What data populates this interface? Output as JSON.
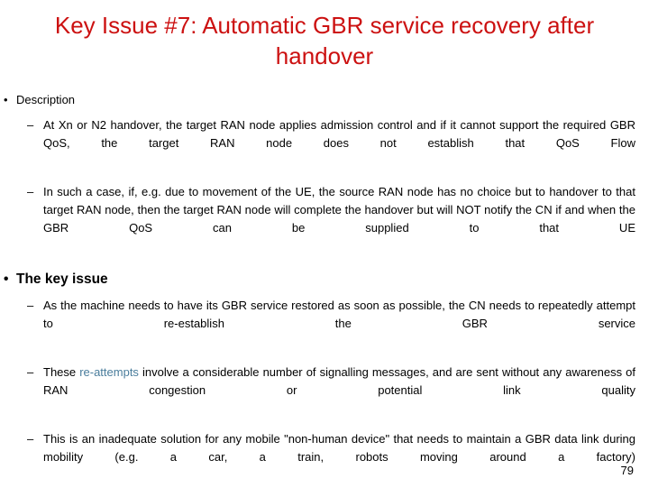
{
  "slide": {
    "title": "Key Issue #7: Automatic GBR service recovery after handover",
    "title_color": "#cc1111",
    "accent_color": "#4a7d9c",
    "page_number": "79",
    "sections": [
      {
        "heading": "Description",
        "bullet_mark": "•",
        "items": [
          {
            "mark": "–",
            "text": "At Xn or N2 handover, the target RAN node applies admission control and if it cannot support the required GBR QoS, the target RAN node does not establish that QoS Flow"
          },
          {
            "mark": "–",
            "text": "In such a case, if, e.g. due to movement of the UE, the source RAN node has no choice but to handover to that target RAN node, then the target RAN node will complete the handover but will NOT notify the CN if and when the GBR QoS can be supplied to that UE"
          }
        ]
      },
      {
        "heading": "The key issue",
        "bullet_mark": "•",
        "items": [
          {
            "mark": "–",
            "text": "As the machine needs to have its GBR service restored as soon as possible, the CN needs to repeatedly attempt to re-establish the GBR service"
          },
          {
            "mark": "–",
            "text_before": "These ",
            "text_accent": "re-attempts",
            "text_after": " involve a considerable number of signalling messages, and are sent without any awareness of RAN congestion or potential link quality"
          },
          {
            "mark": "–",
            "text": "This is an inadequate solution for any mobile \"non-human device\" that needs to maintain a GBR data link during mobility (e.g. a car, a train, robots moving around a factory)"
          }
        ]
      }
    ]
  }
}
